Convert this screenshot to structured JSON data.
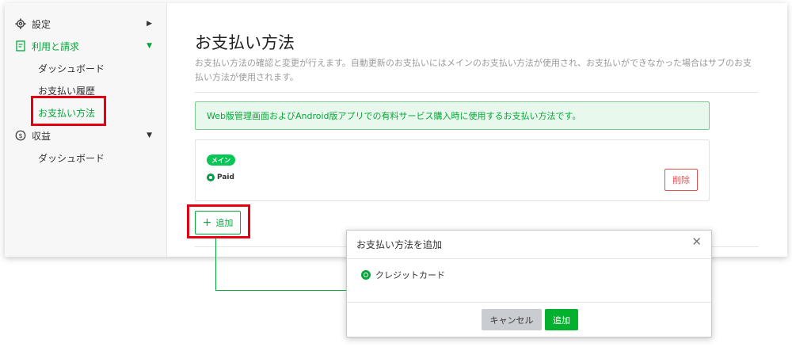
{
  "sidebar": {
    "items": [
      {
        "label": "設定",
        "icon": "gear-icon"
      },
      {
        "label": "利用と請求",
        "icon": "billing-icon"
      },
      {
        "label": "収益",
        "icon": "dollar-icon"
      }
    ],
    "billing_sub": [
      "ダッシュボード",
      "お支払い履歴",
      "お支払い方法"
    ],
    "revenue_sub": [
      "ダッシュボード"
    ]
  },
  "main": {
    "title": "お支払い方法",
    "description": "お支払い方法の確認と変更が行えます。自動更新のお支払いにはメインのお支払い方法が使用され、お支払いができなかった場合はサブのお支払い方法が使用されます。",
    "notice": "Web版管理画面およびAndroid版アプリでの有料サービス購入時に使用するお支払い方法です。",
    "card": {
      "badge": "メイン",
      "brand": "Paid",
      "delete_label": "削除"
    },
    "add_label": "追加"
  },
  "modal": {
    "title": "お支払い方法を追加",
    "option": "クレジットカード",
    "cancel_label": "キャンセル",
    "ok_label": "追加"
  },
  "colors": {
    "accent": "#06a73a",
    "highlight": "#e60012",
    "danger": "#e25252"
  }
}
